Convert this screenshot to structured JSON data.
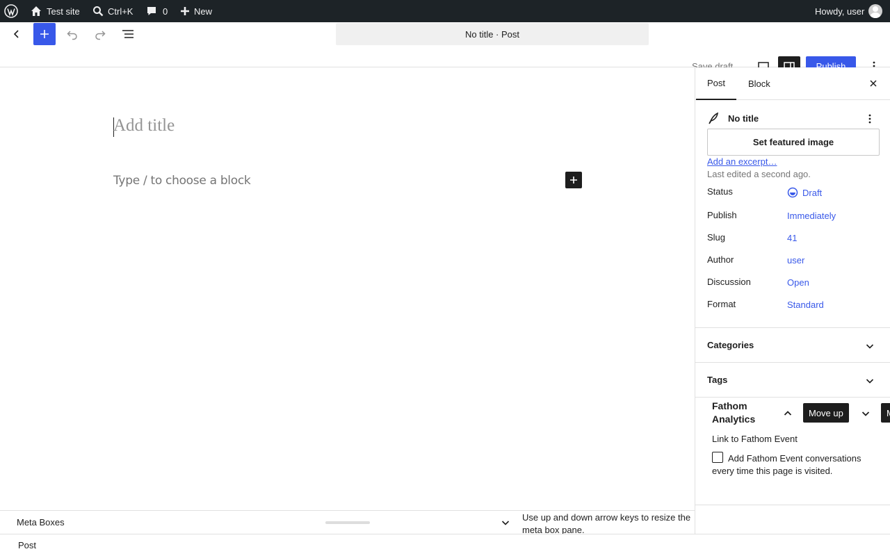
{
  "adminbar": {
    "site_name": "Test site",
    "search_shortcut": "Ctrl+K",
    "comments_count": "0",
    "new_label": "New",
    "greeting": "Howdy, user"
  },
  "header": {
    "document_title": "No title · Post",
    "save_draft_label": "Save draft",
    "publish_label": "Publish"
  },
  "canvas": {
    "title_placeholder": "Add title",
    "block_placeholder": "Type / to choose a block"
  },
  "sidebar": {
    "tabs": [
      {
        "label": "Post"
      },
      {
        "label": "Block"
      }
    ],
    "post_title": "No title",
    "featured_image_label": "Set featured image",
    "excerpt_link": "Add an excerpt…",
    "last_edited": "Last edited a second ago.",
    "rows": [
      {
        "label": "Status",
        "value": "Draft"
      },
      {
        "label": "Publish",
        "value": "Immediately"
      },
      {
        "label": "Slug",
        "value": "41"
      },
      {
        "label": "Author",
        "value": "user"
      },
      {
        "label": "Discussion",
        "value": "Open"
      },
      {
        "label": "Format",
        "value": "Standard"
      }
    ],
    "panels": [
      {
        "title": "Categories"
      },
      {
        "title": "Tags"
      }
    ],
    "fathom": {
      "title": "Fathom Analytics",
      "move_up_tooltip": "Move up",
      "move_down_tooltip": "M",
      "link_label": "Link to Fathom Event",
      "checkbox_label": "Add Fathom Event conversations every time this page is visited.",
      "checkbox_checked": false
    }
  },
  "metaboxes": {
    "label": "Meta Boxes",
    "resize_hint": "Use up and down arrow keys to resize the meta box pane."
  },
  "footer": {
    "breadcrumb": "Post"
  },
  "colors": {
    "accent": "#3858e9",
    "adminbar_bg": "#1d2327"
  }
}
